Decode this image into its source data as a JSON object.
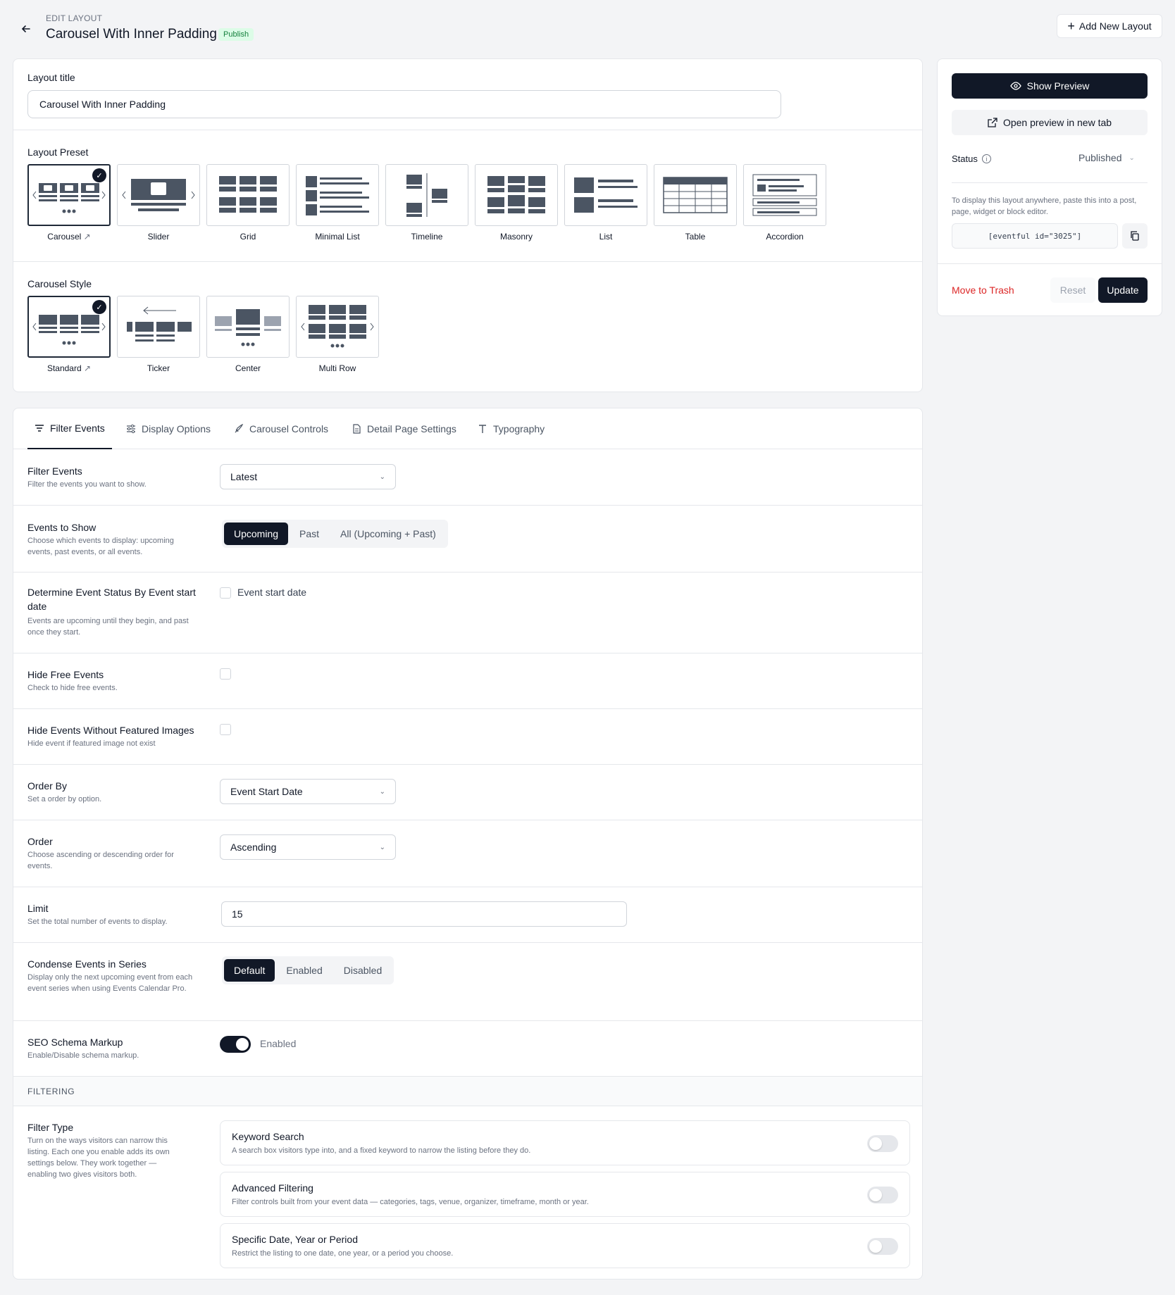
{
  "header": {
    "eyebrow": "EDIT LAYOUT",
    "title": "Carousel With Inner Padding",
    "status_badge": "Publish",
    "add_new": "Add New Layout"
  },
  "layout": {
    "title_label": "Layout title",
    "title_value": "Carousel With Inner Padding",
    "preset_label": "Layout Preset",
    "presets": [
      "Carousel",
      "Slider",
      "Grid",
      "Minimal List",
      "Timeline",
      "Masonry",
      "List",
      "Table",
      "Accordion"
    ],
    "style_label": "Carousel Style",
    "styles": [
      "Standard",
      "Ticker",
      "Center",
      "Multi Row"
    ]
  },
  "tabs": [
    "Filter Events",
    "Display Options",
    "Carousel Controls",
    "Detail Page Settings",
    "Typography"
  ],
  "settings": {
    "filter_events": {
      "title": "Filter Events",
      "desc": "Filter the events you want to show.",
      "value": "Latest"
    },
    "events_to_show": {
      "title": "Events to Show",
      "desc": "Choose which events to display: upcoming events, past events, or all events.",
      "options": [
        "Upcoming",
        "Past",
        "All (Upcoming + Past)"
      ]
    },
    "determine": {
      "title": "Determine Event Status By Event start date",
      "desc": "Events are upcoming until they begin, and past once they start.",
      "checkbox_label": "Event start date"
    },
    "hide_free": {
      "title": "Hide Free Events",
      "desc": "Check to hide free events."
    },
    "hide_no_image": {
      "title": "Hide Events Without Featured Images",
      "desc": "Hide event if featured image not exist"
    },
    "order_by": {
      "title": "Order By",
      "desc": "Set a order by option.",
      "value": "Event Start Date"
    },
    "order": {
      "title": "Order",
      "desc": "Choose ascending or descending order for events.",
      "value": "Ascending"
    },
    "limit": {
      "title": "Limit",
      "desc": "Set the total number of events to display.",
      "value": "15"
    },
    "condense": {
      "title": "Condense Events in Series",
      "desc": "Display only the next upcoming event from each event series when using Events Calendar Pro.",
      "options": [
        "Default",
        "Enabled",
        "Disabled"
      ]
    },
    "seo": {
      "title": "SEO Schema Markup",
      "desc": "Enable/Disable schema markup.",
      "toggle_label": "Enabled"
    }
  },
  "filtering": {
    "section": "FILTERING",
    "title": "Filter Type",
    "desc": "Turn on the ways visitors can narrow this listing. Each one you enable adds its own settings below. They work together — enabling two gives visitors both.",
    "cards": [
      {
        "title": "Keyword Search",
        "desc": "A search box visitors type into, and a fixed keyword to narrow the listing before they do."
      },
      {
        "title": "Advanced Filtering",
        "desc": "Filter controls built from your event data — categories, tags, venue, organizer, timeframe, month or year."
      },
      {
        "title": "Specific Date, Year or Period",
        "desc": "Restrict the listing to one date, one year, or a period you choose."
      }
    ]
  },
  "sidebar": {
    "show_preview": "Show Preview",
    "open_new_tab": "Open preview in new tab",
    "status_label": "Status",
    "status_value": "Published",
    "embed_help": "To display this layout anywhere, paste this into a post, page, widget or block editor.",
    "shortcode": "[eventful id=\"3025\"]",
    "trash": "Move to Trash",
    "reset": "Reset",
    "update": "Update"
  }
}
